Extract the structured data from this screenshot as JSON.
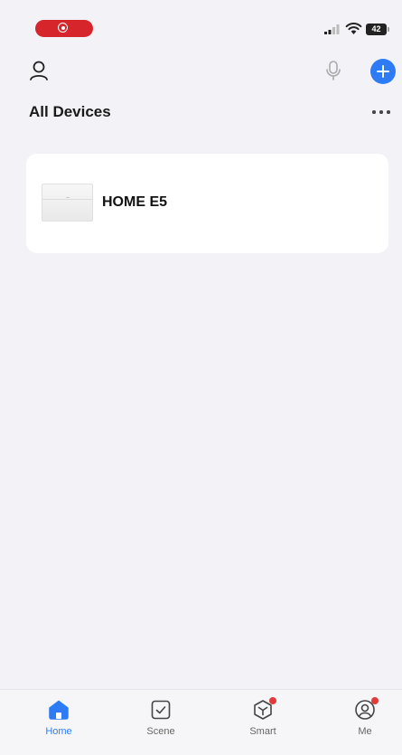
{
  "status_bar": {
    "battery_level": "42",
    "recording_color": "#d7262b"
  },
  "top_bar": {
    "profile_icon": "person-icon",
    "mic_icon": "microphone-icon",
    "add_icon": "plus-icon",
    "accent_color": "#2d7cf6"
  },
  "section": {
    "title": "All Devices",
    "more_icon": "ellipsis-icon"
  },
  "devices": [
    {
      "name": "HOME E5",
      "icon": "device-thumbnail"
    }
  ],
  "tab_bar": {
    "tabs": [
      {
        "label": "Home",
        "icon": "home-icon",
        "active": true,
        "badge": false
      },
      {
        "label": "Scene",
        "icon": "scene-checkbox-icon",
        "active": false,
        "badge": false
      },
      {
        "label": "Smart",
        "icon": "smart-cube-icon",
        "active": false,
        "badge": true
      },
      {
        "label": "Me",
        "icon": "me-profile-icon",
        "active": false,
        "badge": true
      }
    ]
  }
}
